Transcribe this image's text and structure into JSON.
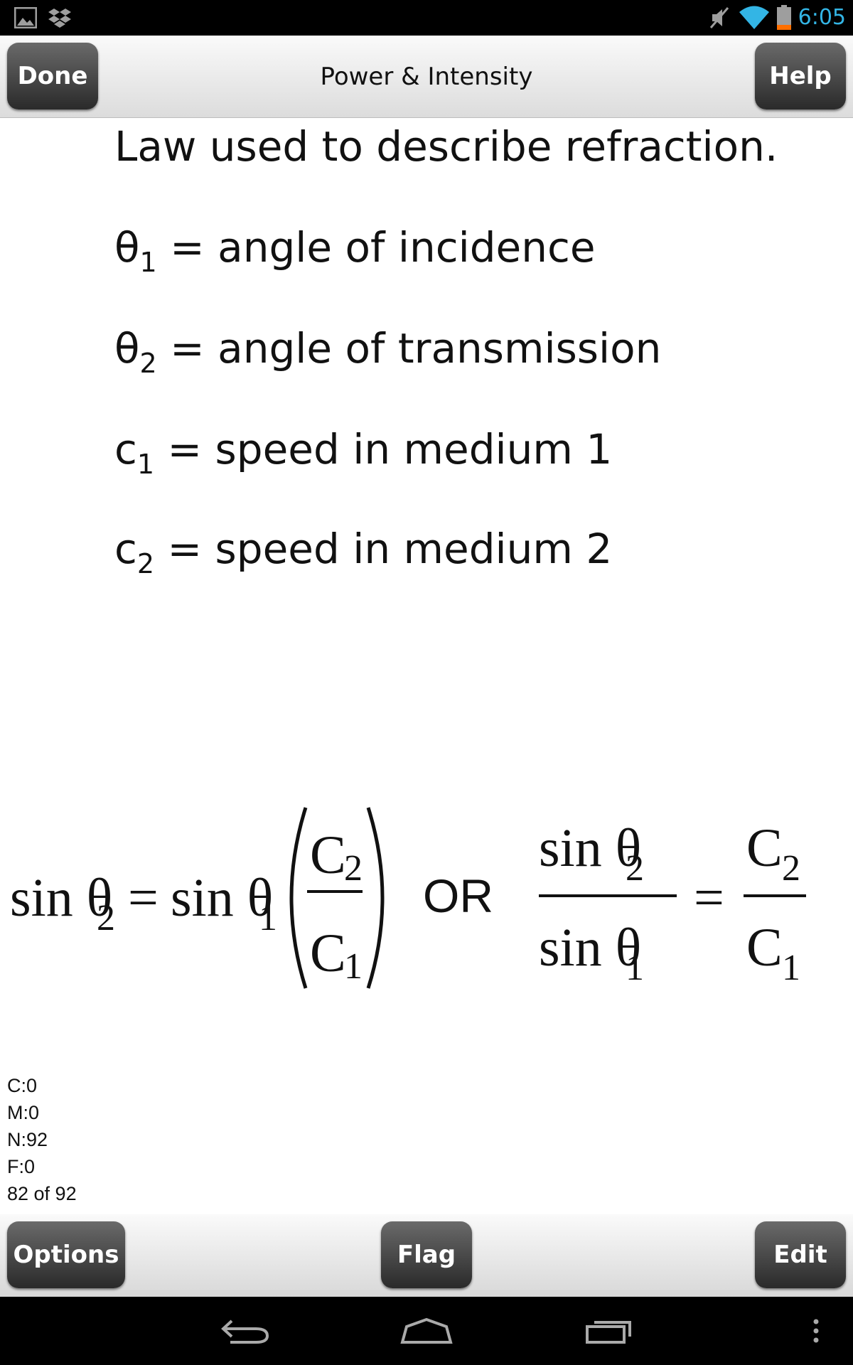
{
  "status_bar": {
    "time": "6:05",
    "icons": [
      "gallery-icon",
      "dropbox-icon",
      "mute-icon",
      "wifi-icon",
      "battery-icon"
    ],
    "time_color": "#33b5e5"
  },
  "header": {
    "title": "Power & Intensity",
    "done_label": "Done",
    "help_label": "Help"
  },
  "card": {
    "heading": "Law used to describe refraction.",
    "definitions": [
      {
        "symbol": "θ",
        "sub": "1",
        "text": " = angle of incidence"
      },
      {
        "symbol": "θ",
        "sub": "2",
        "text": " = angle of transmission"
      },
      {
        "symbol": "c",
        "sub": "1",
        "text": " = speed in medium 1"
      },
      {
        "symbol": "c",
        "sub": "2",
        "text": " = speed in medium 2"
      }
    ],
    "formula": {
      "lhs1": "sin θ",
      "lhs1_sub": "2",
      "eq": "=",
      "rhs1": "sin θ",
      "rhs1_sub": "1",
      "frac_num": "C",
      "frac_num_sub": "2",
      "frac_den": "C",
      "frac_den_sub": "1",
      "or": "OR",
      "f2_num": "sin θ",
      "f2_num_sub": "2",
      "f2_den": "sin θ",
      "f2_den_sub": "1",
      "f2_eq": "=",
      "f2_rnum": "C",
      "f2_rnum_sub": "2",
      "f2_rden": "C",
      "f2_rden_sub": "1"
    }
  },
  "stats": {
    "c": "C:0",
    "m": "M:0",
    "n": "N:92",
    "f": "F:0",
    "progress": "82 of 92"
  },
  "toolbar": {
    "options_label": "Options",
    "flag_label": "Flag",
    "edit_label": "Edit"
  },
  "nav_bar": {
    "icons": [
      "back-icon",
      "home-icon",
      "recents-icon",
      "menu-icon"
    ]
  }
}
